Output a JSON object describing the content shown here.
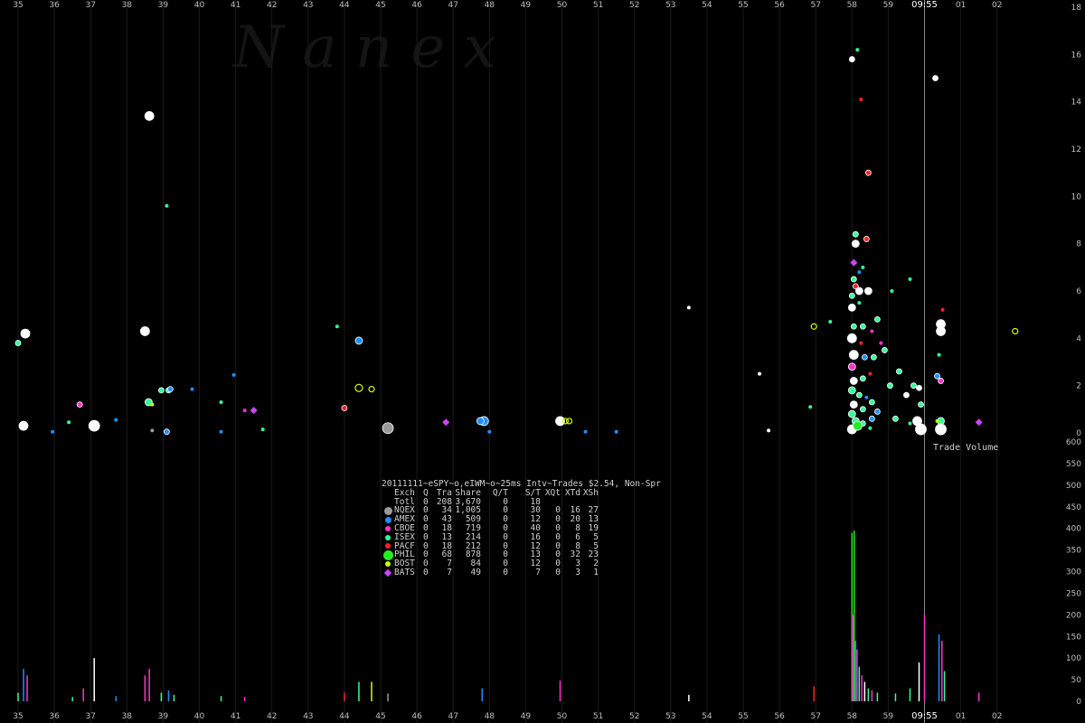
{
  "watermark": "N  a  n  e  x",
  "chart_data": {
    "type": "scatter",
    "x_ticks": [
      "35",
      "36",
      "37",
      "38",
      "39",
      "40",
      "41",
      "42",
      "43",
      "44",
      "45",
      "46",
      "47",
      "48",
      "49",
      "50",
      "51",
      "52",
      "53",
      "54",
      "55",
      "56",
      "57",
      "58",
      "59",
      "09:55",
      "01",
      "02"
    ],
    "highlight_tick": "09:55",
    "price_axis": {
      "ticks": [
        "18",
        "16",
        "14",
        "12",
        "10",
        "8",
        "6",
        "4",
        "2",
        "0"
      ],
      "ylim": [
        0,
        18
      ]
    },
    "volume_axis": {
      "title": "Trade Volume",
      "ticks": [
        "600",
        "550",
        "500",
        "450",
        "400",
        "350",
        "300",
        "250",
        "200",
        "150",
        "100",
        "50",
        "0"
      ],
      "ylim": [
        0,
        600
      ]
    },
    "marker_time": "09:55",
    "exchanges": [
      {
        "name": "NQEX",
        "color": "#9a9a9a",
        "shape": "circle-lg"
      },
      {
        "name": "AMEX",
        "color": "#1e90ff",
        "shape": "circle"
      },
      {
        "name": "CBOE",
        "color": "#ff33cc",
        "shape": "circle-sm"
      },
      {
        "name": "ISEX",
        "color": "#33ff99",
        "shape": "circle-sm"
      },
      {
        "name": "PACF",
        "color": "#ff2222",
        "shape": "circle-sm"
      },
      {
        "name": "PHIL",
        "color": "#22ee22",
        "shape": "circle-xl"
      },
      {
        "name": "BOST",
        "color": "#ccff00",
        "shape": "circle-sm"
      },
      {
        "name": "BATS",
        "color": "#cc44ff",
        "shape": "diamond"
      }
    ],
    "points": [
      {
        "t": 35.0,
        "p": 3.8,
        "c": "#33ff99",
        "s": 3
      },
      {
        "t": 35.15,
        "p": 0.3,
        "c": "#ffffff",
        "s": 5
      },
      {
        "t": 35.2,
        "p": 4.2,
        "c": "#ffffff",
        "s": 5
      },
      {
        "t": 35.95,
        "p": 0.05,
        "c": "#1e90ff",
        "s": 2
      },
      {
        "t": 36.4,
        "p": 0.45,
        "c": "#33ff99",
        "s": 2
      },
      {
        "t": 36.7,
        "p": 1.2,
        "c": "#ff33cc",
        "s": 3
      },
      {
        "t": 37.1,
        "p": 0.3,
        "c": "#ffffff",
        "s": 6
      },
      {
        "t": 37.7,
        "p": 0.55,
        "c": "#1e90ff",
        "s": 2
      },
      {
        "t": 38.5,
        "p": 4.3,
        "c": "#ffffff",
        "s": 5
      },
      {
        "t": 38.62,
        "p": 13.4,
        "c": "#ffffff",
        "s": 5
      },
      {
        "t": 38.6,
        "p": 1.3,
        "c": "#33ff99",
        "s": 4
      },
      {
        "t": 38.7,
        "p": 1.2,
        "c": "#ccff00",
        "s": 2
      },
      {
        "t": 38.7,
        "p": 0.1,
        "c": "#9a9a9a",
        "s": 2
      },
      {
        "t": 38.95,
        "p": 1.8,
        "c": "#33ff99",
        "s": 3
      },
      {
        "t": 39.1,
        "p": 9.6,
        "c": "#33ff99",
        "s": 2
      },
      {
        "t": 39.15,
        "p": 1.8,
        "c": "#33ff99",
        "s": 3
      },
      {
        "t": 39.2,
        "p": 1.85,
        "c": "#1e90ff",
        "s": 3
      },
      {
        "t": 39.1,
        "p": 0.05,
        "c": "#1e90ff",
        "s": 3
      },
      {
        "t": 39.8,
        "p": 1.85,
        "c": "#1e90ff",
        "s": 2
      },
      {
        "t": 40.6,
        "p": 1.3,
        "c": "#33ff99",
        "s": 2
      },
      {
        "t": 40.6,
        "p": 0.05,
        "c": "#1e90ff",
        "s": 2
      },
      {
        "t": 40.95,
        "p": 2.45,
        "c": "#1e90ff",
        "s": 2
      },
      {
        "t": 41.25,
        "p": 0.95,
        "c": "#ff33cc",
        "s": 2
      },
      {
        "t": 41.5,
        "p": 0.95,
        "c": "#cc44ff",
        "s": 3
      },
      {
        "t": 41.75,
        "p": 0.15,
        "c": "#33ff99",
        "s": 2
      },
      {
        "t": 43.8,
        "p": 4.5,
        "c": "#33ff99",
        "s": 2
      },
      {
        "t": 44.0,
        "p": 1.05,
        "c": "#ff2222",
        "s": 3
      },
      {
        "t": 44.4,
        "p": 3.9,
        "c": "#1e90ff",
        "s": 4
      },
      {
        "t": 44.4,
        "p": 1.9,
        "c": "#ccff00",
        "s": 4
      },
      {
        "t": 44.75,
        "p": 1.85,
        "c": "#ccff00",
        "s": 3
      },
      {
        "t": 45.2,
        "p": 0.2,
        "c": "#9a9a9a",
        "s": 6
      },
      {
        "t": 46.8,
        "p": 0.45,
        "c": "#cc44ff",
        "s": 3
      },
      {
        "t": 47.85,
        "p": 0.5,
        "c": "#1e90ff",
        "s": 5
      },
      {
        "t": 47.75,
        "p": 0.5,
        "c": "#1e90ff",
        "s": 4
      },
      {
        "t": 48.0,
        "p": 0.05,
        "c": "#1e90ff",
        "s": 2
      },
      {
        "t": 49.95,
        "p": 0.5,
        "c": "#ffffff",
        "s": 5
      },
      {
        "t": 50.1,
        "p": 0.5,
        "c": "#ccff00",
        "s": 3
      },
      {
        "t": 50.2,
        "p": 0.5,
        "c": "#ccff00",
        "s": 3
      },
      {
        "t": 50.65,
        "p": 0.05,
        "c": "#1e90ff",
        "s": 2
      },
      {
        "t": 51.5,
        "p": 0.05,
        "c": "#1e90ff",
        "s": 2
      },
      {
        "t": 53.5,
        "p": 5.3,
        "c": "#ffffff",
        "s": 2
      },
      {
        "t": 55.45,
        "p": 2.5,
        "c": "#ffffff",
        "s": 2
      },
      {
        "t": 55.7,
        "p": 0.1,
        "c": "#ffffff",
        "s": 2
      },
      {
        "t": 56.85,
        "p": 1.1,
        "c": "#33ff99",
        "s": 2
      },
      {
        "t": 56.95,
        "p": 4.5,
        "c": "#ccff00",
        "s": 3
      },
      {
        "t": 57.4,
        "p": 4.7,
        "c": "#33ff99",
        "s": 2
      },
      {
        "t": 58.0,
        "p": 15.8,
        "c": "#ffffff",
        "s": 3
      },
      {
        "t": 58.15,
        "p": 16.2,
        "c": "#33ff99",
        "s": 2
      },
      {
        "t": 58.25,
        "p": 14.1,
        "c": "#ff2222",
        "s": 2
      },
      {
        "t": 58.45,
        "p": 11.0,
        "c": "#ff2222",
        "s": 3
      },
      {
        "t": 58.1,
        "p": 8.4,
        "c": "#33ff99",
        "s": 3
      },
      {
        "t": 58.1,
        "p": 8.0,
        "c": "#ffffff",
        "s": 4
      },
      {
        "t": 58.4,
        "p": 8.2,
        "c": "#ff2222",
        "s": 3
      },
      {
        "t": 58.05,
        "p": 7.2,
        "c": "#cc44ff",
        "s": 3
      },
      {
        "t": 58.2,
        "p": 6.8,
        "c": "#1e90ff",
        "s": 2
      },
      {
        "t": 58.3,
        "p": 7.0,
        "c": "#33ff99",
        "s": 2
      },
      {
        "t": 58.05,
        "p": 6.5,
        "c": "#33ff99",
        "s": 3
      },
      {
        "t": 58.1,
        "p": 6.2,
        "c": "#ff2222",
        "s": 3
      },
      {
        "t": 58.2,
        "p": 6.0,
        "c": "#ffffff",
        "s": 4
      },
      {
        "t": 58.45,
        "p": 6.0,
        "c": "#ffffff",
        "s": 4
      },
      {
        "t": 58.0,
        "p": 5.8,
        "c": "#33ff99",
        "s": 3
      },
      {
        "t": 58.0,
        "p": 5.3,
        "c": "#ffffff",
        "s": 4
      },
      {
        "t": 58.2,
        "p": 5.5,
        "c": "#33ff99",
        "s": 2
      },
      {
        "t": 58.05,
        "p": 4.5,
        "c": "#33ff99",
        "s": 3
      },
      {
        "t": 58.3,
        "p": 4.5,
        "c": "#33ff99",
        "s": 3
      },
      {
        "t": 58.7,
        "p": 4.8,
        "c": "#33ff99",
        "s": 3
      },
      {
        "t": 58.55,
        "p": 4.3,
        "c": "#ff33cc",
        "s": 2
      },
      {
        "t": 58.0,
        "p": 4.0,
        "c": "#ffffff",
        "s": 5
      },
      {
        "t": 58.25,
        "p": 3.8,
        "c": "#ff2222",
        "s": 2
      },
      {
        "t": 58.8,
        "p": 3.8,
        "c": "#ff33cc",
        "s": 2
      },
      {
        "t": 58.05,
        "p": 3.3,
        "c": "#ffffff",
        "s": 5
      },
      {
        "t": 58.35,
        "p": 3.2,
        "c": "#1e90ff",
        "s": 3
      },
      {
        "t": 58.6,
        "p": 3.2,
        "c": "#33ff99",
        "s": 3
      },
      {
        "t": 58.0,
        "p": 2.8,
        "c": "#ff33cc",
        "s": 4
      },
      {
        "t": 58.5,
        "p": 2.5,
        "c": "#ff2222",
        "s": 2
      },
      {
        "t": 58.05,
        "p": 2.2,
        "c": "#ffffff",
        "s": 4
      },
      {
        "t": 58.3,
        "p": 2.3,
        "c": "#33ff99",
        "s": 3
      },
      {
        "t": 58.0,
        "p": 1.8,
        "c": "#33ff99",
        "s": 4
      },
      {
        "t": 58.2,
        "p": 1.6,
        "c": "#33ff99",
        "s": 3
      },
      {
        "t": 58.4,
        "p": 1.5,
        "c": "#1e90ff",
        "s": 2
      },
      {
        "t": 58.55,
        "p": 1.3,
        "c": "#33ff99",
        "s": 3
      },
      {
        "t": 58.05,
        "p": 1.2,
        "c": "#ffffff",
        "s": 4
      },
      {
        "t": 58.3,
        "p": 1.0,
        "c": "#33ff99",
        "s": 3
      },
      {
        "t": 58.0,
        "p": 0.8,
        "c": "#33ff99",
        "s": 4
      },
      {
        "t": 58.7,
        "p": 0.9,
        "c": "#1e90ff",
        "s": 3
      },
      {
        "t": 58.1,
        "p": 0.5,
        "c": "#33ff99",
        "s": 4
      },
      {
        "t": 58.3,
        "p": 0.4,
        "c": "#33ff99",
        "s": 3
      },
      {
        "t": 58.0,
        "p": 0.15,
        "c": "#ffffff",
        "s": 5
      },
      {
        "t": 58.15,
        "p": 0.3,
        "c": "#22ee22",
        "s": 5
      },
      {
        "t": 58.5,
        "p": 0.2,
        "c": "#33ff99",
        "s": 2
      },
      {
        "t": 58.55,
        "p": 0.6,
        "c": "#1e90ff",
        "s": 3
      },
      {
        "t": 59.1,
        "p": 6.0,
        "c": "#33ff99",
        "s": 2
      },
      {
        "t": 58.9,
        "p": 3.5,
        "c": "#33ff99",
        "s": 3
      },
      {
        "t": 59.3,
        "p": 2.6,
        "c": "#33ff99",
        "s": 3
      },
      {
        "t": 59.05,
        "p": 2.0,
        "c": "#33ff99",
        "s": 3
      },
      {
        "t": 59.5,
        "p": 1.6,
        "c": "#ffffff",
        "s": 3
      },
      {
        "t": 59.2,
        "p": 0.6,
        "c": "#33ff99",
        "s": 3
      },
      {
        "t": 59.6,
        "p": 0.4,
        "c": "#33ff99",
        "s": 2
      },
      {
        "t": 59.6,
        "p": 6.5,
        "c": "#33ff99",
        "s": 2
      },
      {
        "t": 59.7,
        "p": 2.0,
        "c": "#33ff99",
        "s": 3
      },
      {
        "t": 59.85,
        "p": 1.9,
        "c": "#ffffff",
        "s": 3
      },
      {
        "t": 59.9,
        "p": 1.2,
        "c": "#33ff99",
        "s": 3
      },
      {
        "t": 59.8,
        "p": 0.5,
        "c": "#ffffff",
        "s": 5
      },
      {
        "t": 59.9,
        "p": 0.15,
        "c": "#ffffff",
        "s": 6
      },
      {
        "t": 60.3,
        "p": 15.0,
        "c": "#ffffff",
        "s": 3
      },
      {
        "t": 60.45,
        "p": 4.6,
        "c": "#ffffff",
        "s": 5
      },
      {
        "t": 60.45,
        "p": 4.3,
        "c": "#ffffff",
        "s": 5
      },
      {
        "t": 60.5,
        "p": 5.2,
        "c": "#ff2222",
        "s": 2
      },
      {
        "t": 60.4,
        "p": 3.3,
        "c": "#33ff99",
        "s": 2
      },
      {
        "t": 60.35,
        "p": 2.4,
        "c": "#1e90ff",
        "s": 3
      },
      {
        "t": 60.45,
        "p": 2.2,
        "c": "#ff33cc",
        "s": 3
      },
      {
        "t": 60.45,
        "p": 0.5,
        "c": "#33ff99",
        "s": 4
      },
      {
        "t": 60.45,
        "p": 0.15,
        "c": "#ffffff",
        "s": 6
      },
      {
        "t": 60.35,
        "p": 0.5,
        "c": "#ccff00",
        "s": 2
      },
      {
        "t": 61.5,
        "p": 0.45,
        "c": "#cc44ff",
        "s": 3
      },
      {
        "t": 62.5,
        "p": 4.3,
        "c": "#ccff00",
        "s": 3
      }
    ],
    "volume_bars": [
      {
        "t": 35.0,
        "v": 20,
        "c": "#33ff99"
      },
      {
        "t": 35.15,
        "v": 75,
        "c": "#1e90ff"
      },
      {
        "t": 35.25,
        "v": 60,
        "c": "#ff33cc"
      },
      {
        "t": 36.5,
        "v": 10,
        "c": "#33ff99"
      },
      {
        "t": 36.8,
        "v": 30,
        "c": "#ff33cc"
      },
      {
        "t": 37.1,
        "v": 100,
        "c": "#ffffff"
      },
      {
        "t": 37.7,
        "v": 12,
        "c": "#1e90ff"
      },
      {
        "t": 38.5,
        "v": 60,
        "c": "#ff33cc"
      },
      {
        "t": 38.62,
        "v": 75,
        "c": "#ff33cc"
      },
      {
        "t": 38.95,
        "v": 20,
        "c": "#33ff99"
      },
      {
        "t": 39.15,
        "v": 25,
        "c": "#1e90ff"
      },
      {
        "t": 39.3,
        "v": 15,
        "c": "#33ff99"
      },
      {
        "t": 40.6,
        "v": 12,
        "c": "#33ff99"
      },
      {
        "t": 41.25,
        "v": 10,
        "c": "#ff33cc"
      },
      {
        "t": 44.0,
        "v": 20,
        "c": "#ff2222"
      },
      {
        "t": 44.4,
        "v": 45,
        "c": "#33ff99"
      },
      {
        "t": 44.75,
        "v": 45,
        "c": "#ccff00"
      },
      {
        "t": 45.2,
        "v": 18,
        "c": "#9a9a9a"
      },
      {
        "t": 47.8,
        "v": 30,
        "c": "#1e90ff"
      },
      {
        "t": 49.95,
        "v": 48,
        "c": "#ff33cc"
      },
      {
        "t": 53.5,
        "v": 15,
        "c": "#ffffff"
      },
      {
        "t": 56.95,
        "v": 35,
        "c": "#ff2222"
      },
      {
        "t": 58.0,
        "v": 390,
        "c": "#22ee22"
      },
      {
        "t": 58.06,
        "v": 395,
        "c": "#22ee22"
      },
      {
        "t": 58.02,
        "v": 200,
        "c": "#ff33cc"
      },
      {
        "t": 58.1,
        "v": 140,
        "c": "#1e90ff"
      },
      {
        "t": 58.14,
        "v": 120,
        "c": "#ff33cc"
      },
      {
        "t": 58.2,
        "v": 80,
        "c": "#33ff99"
      },
      {
        "t": 58.27,
        "v": 60,
        "c": "#ff33cc"
      },
      {
        "t": 58.35,
        "v": 45,
        "c": "#ffffff"
      },
      {
        "t": 58.45,
        "v": 30,
        "c": "#33ff99"
      },
      {
        "t": 58.55,
        "v": 25,
        "c": "#ff33cc"
      },
      {
        "t": 58.7,
        "v": 20,
        "c": "#33ff99"
      },
      {
        "t": 59.2,
        "v": 18,
        "c": "#33ff99"
      },
      {
        "t": 59.6,
        "v": 30,
        "c": "#33ff99"
      },
      {
        "t": 59.85,
        "v": 90,
        "c": "#ffffff"
      },
      {
        "t": 60.0,
        "v": 200,
        "c": "#ff33cc"
      },
      {
        "t": 60.4,
        "v": 155,
        "c": "#1e90ff"
      },
      {
        "t": 60.48,
        "v": 140,
        "c": "#ff33cc"
      },
      {
        "t": 60.55,
        "v": 70,
        "c": "#33ff99"
      },
      {
        "t": 61.5,
        "v": 20,
        "c": "#ff33cc"
      }
    ]
  },
  "legend": {
    "title": "20111111~eSPY~o,eIWM~o~25ms Intv~Trades $2.54, Non-Spr",
    "header": [
      "Exch",
      "Q",
      "Tra",
      "Share",
      "Q/T",
      "S/T",
      "XQt",
      "XTd",
      "XSh"
    ],
    "total": [
      "Totl",
      "0",
      "208",
      "3,670",
      "0",
      "18",
      "",
      "",
      ""
    ],
    "rows": [
      [
        "NQEX",
        "0",
        "34",
        "1,005",
        "0",
        "30",
        "0",
        "16",
        "27"
      ],
      [
        "AMEX",
        "0",
        "43",
        "509",
        "0",
        "12",
        "0",
        "20",
        "13"
      ],
      [
        "CBOE",
        "0",
        "18",
        "719",
        "0",
        "40",
        "0",
        "8",
        "19"
      ],
      [
        "ISEX",
        "0",
        "13",
        "214",
        "0",
        "16",
        "0",
        "6",
        "5"
      ],
      [
        "PACF",
        "0",
        "18",
        "212",
        "0",
        "12",
        "0",
        "8",
        "5"
      ],
      [
        "PHIL",
        "0",
        "68",
        "878",
        "0",
        "13",
        "0",
        "32",
        "23"
      ],
      [
        "BOST",
        "0",
        "7",
        "84",
        "0",
        "12",
        "0",
        "3",
        "2"
      ],
      [
        "BATS",
        "0",
        "7",
        "49",
        "0",
        "7",
        "0",
        "3",
        "1"
      ]
    ]
  }
}
